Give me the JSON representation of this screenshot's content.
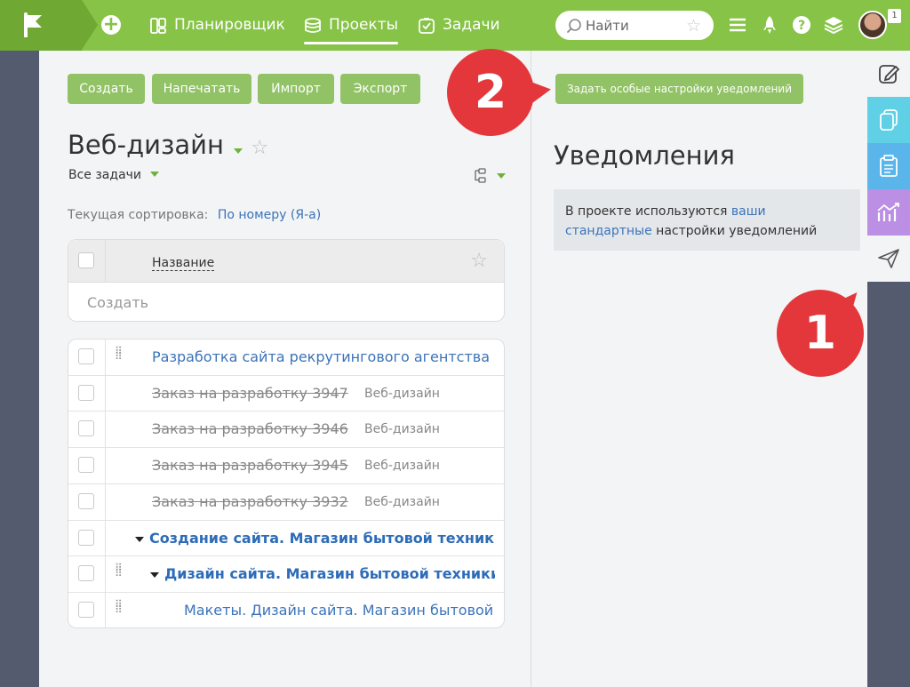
{
  "nav": {
    "items": [
      {
        "label": "Планировщик"
      },
      {
        "label": "Проекты"
      },
      {
        "label": "Задачи"
      }
    ],
    "search_placeholder": "Найти",
    "notifications_count": "1"
  },
  "toolbar": {
    "create": "Создать",
    "print": "Напечатать",
    "import": "Импорт",
    "export": "Экспорт",
    "special_settings": "Задать особые настройки уведомлений"
  },
  "project": {
    "title": "Веб-дизайн",
    "filter": "Все задачи",
    "sort_label": "Текущая сортировка:",
    "sort_value": "По номеру (Я-а)"
  },
  "table": {
    "column_name": "Название",
    "create_placeholder": "Создать",
    "rows": [
      {
        "title": "Разработка сайта рекрутингового агентства",
        "project": ""
      },
      {
        "title": "Заказ на разработку 3947",
        "project": "Веб-дизайн"
      },
      {
        "title": "Заказ на разработку 3946",
        "project": "Веб-дизайн"
      },
      {
        "title": "Заказ на разработку 3945",
        "project": "Веб-дизайн"
      },
      {
        "title": "Заказ на разработку 3932",
        "project": "Веб-дизайн"
      },
      {
        "title": "Создание сайта. Магазин бытовой техники",
        "project": ""
      },
      {
        "title": "Дизайн сайта. Магазин бытовой техники",
        "project": ""
      },
      {
        "title": "Макеты. Дизайн сайта. Магазин бытовой техники",
        "project": ""
      }
    ]
  },
  "notifications": {
    "title": "Уведомления",
    "text_before": "В проекте используются ",
    "link": "ваши стандартные",
    "text_after": " настройки уведомлений"
  },
  "callouts": {
    "one": "1",
    "two": "2"
  },
  "colors": {
    "topbar": "#86c347",
    "button": "#91c265",
    "callout": "#e3373c",
    "link": "#3b73b9",
    "sidebar": "#545b6e"
  }
}
